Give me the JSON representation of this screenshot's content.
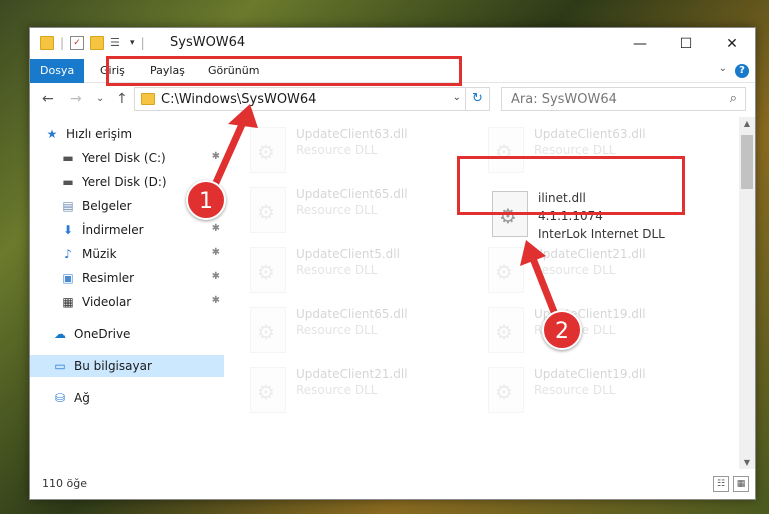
{
  "window": {
    "title": "SysWOW64",
    "controls": {
      "minimize": "—",
      "maximize": "☐",
      "close": "✕"
    }
  },
  "ribbon": {
    "tabs": [
      "Dosya",
      "Giriş",
      "Paylaş",
      "Görünüm"
    ],
    "help": "?",
    "expand": "⌄"
  },
  "nav": {
    "back": "←",
    "forward": "→",
    "recent": "⌄",
    "up": "↑",
    "address": "C:\\Windows\\SysWOW64",
    "address_dropdown": "⌄",
    "refresh": "↻",
    "search_placeholder": "Ara: SysWOW64",
    "search_icon": "⌕"
  },
  "sidebar": {
    "items": [
      {
        "label": "Hızlı erişim",
        "icon": "star-icon",
        "pinned": false
      },
      {
        "label": "Yerel Disk (C:)",
        "icon": "drive-icon",
        "pinned": true
      },
      {
        "label": "Yerel Disk (D:)",
        "icon": "drive-icon",
        "pinned": false
      },
      {
        "label": "Belgeler",
        "icon": "document-icon",
        "pinned": true
      },
      {
        "label": "İndirmeler",
        "icon": "download-icon",
        "pinned": true
      },
      {
        "label": "Müzik",
        "icon": "music-icon",
        "pinned": true
      },
      {
        "label": "Resimler",
        "icon": "pictures-icon",
        "pinned": true
      },
      {
        "label": "Videolar",
        "icon": "video-icon",
        "pinned": true
      },
      {
        "label": "OneDrive",
        "icon": "cloud-icon",
        "pinned": false
      },
      {
        "label": "Bu bilgisayar",
        "icon": "computer-icon",
        "pinned": false,
        "selected": true
      },
      {
        "label": "Ağ",
        "icon": "network-icon",
        "pinned": false
      }
    ],
    "pin_glyph": "📌"
  },
  "files": {
    "left": [
      {
        "name": "UpdateClient63.dll",
        "desc": "Resource DLL"
      },
      {
        "name": "UpdateClient65.dll",
        "desc": "Resource DLL"
      },
      {
        "name": "UpdateClient5.dll",
        "desc": "Resource DLL"
      },
      {
        "name": "UpdateClient65.dll",
        "desc": "Resource DLL"
      },
      {
        "name": "UpdateClient21.dll",
        "desc": "Resource DLL"
      }
    ],
    "right": [
      {
        "name": "UpdateClient63.dll",
        "desc": "Resource DLL"
      },
      {
        "name": "UpdateClient21.dll",
        "desc": "Resource DLL"
      },
      {
        "name": "UpdateClient19.dll",
        "desc": "Resource DLL"
      },
      {
        "name": "UpdateClient19.dll",
        "desc": "Resource DLL"
      }
    ],
    "highlighted": {
      "name": "ilinet.dll",
      "version": "4.1.1.1074",
      "desc": "InterLok Internet DLL"
    }
  },
  "annotations": {
    "step1": "1",
    "step2": "2",
    "color": "#e03030"
  },
  "status": {
    "count": "110 öğe",
    "view_details": "☷",
    "view_tiles": "▦"
  }
}
